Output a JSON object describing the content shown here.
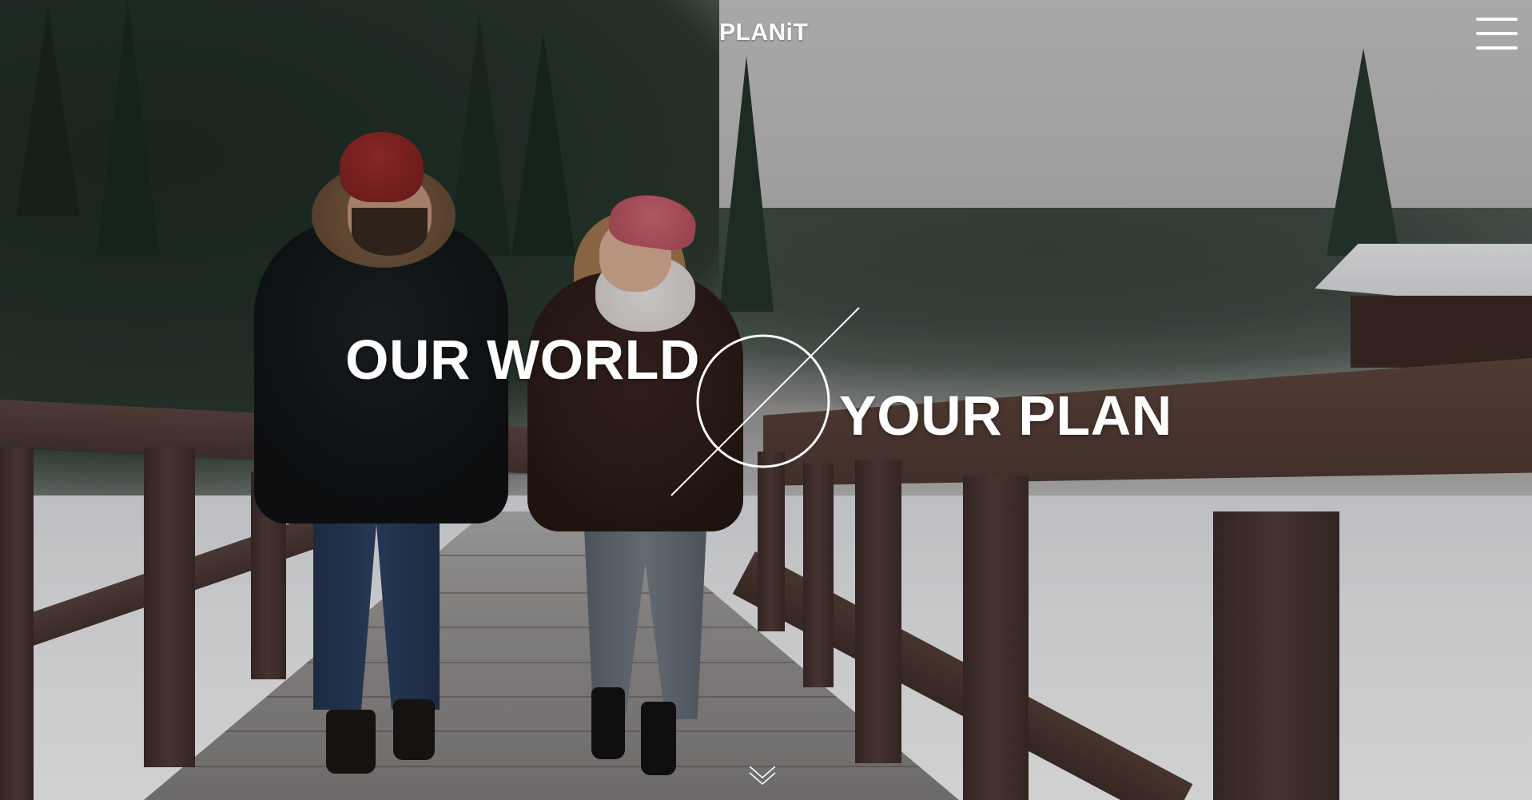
{
  "header": {
    "brand": "PLANiT",
    "menu_icon": "hamburger-menu-icon"
  },
  "hero": {
    "headline_line_1": "OUR WORLD",
    "headline_line_2": "YOUR PLAN",
    "separator_icon": "circle-slash-icon",
    "scroll_icon": "chevron-down-icon",
    "background_image": "couple walking on snowy wooden bridge in winter forest"
  },
  "colors": {
    "text": "#ffffff",
    "overlay": "#000000"
  }
}
